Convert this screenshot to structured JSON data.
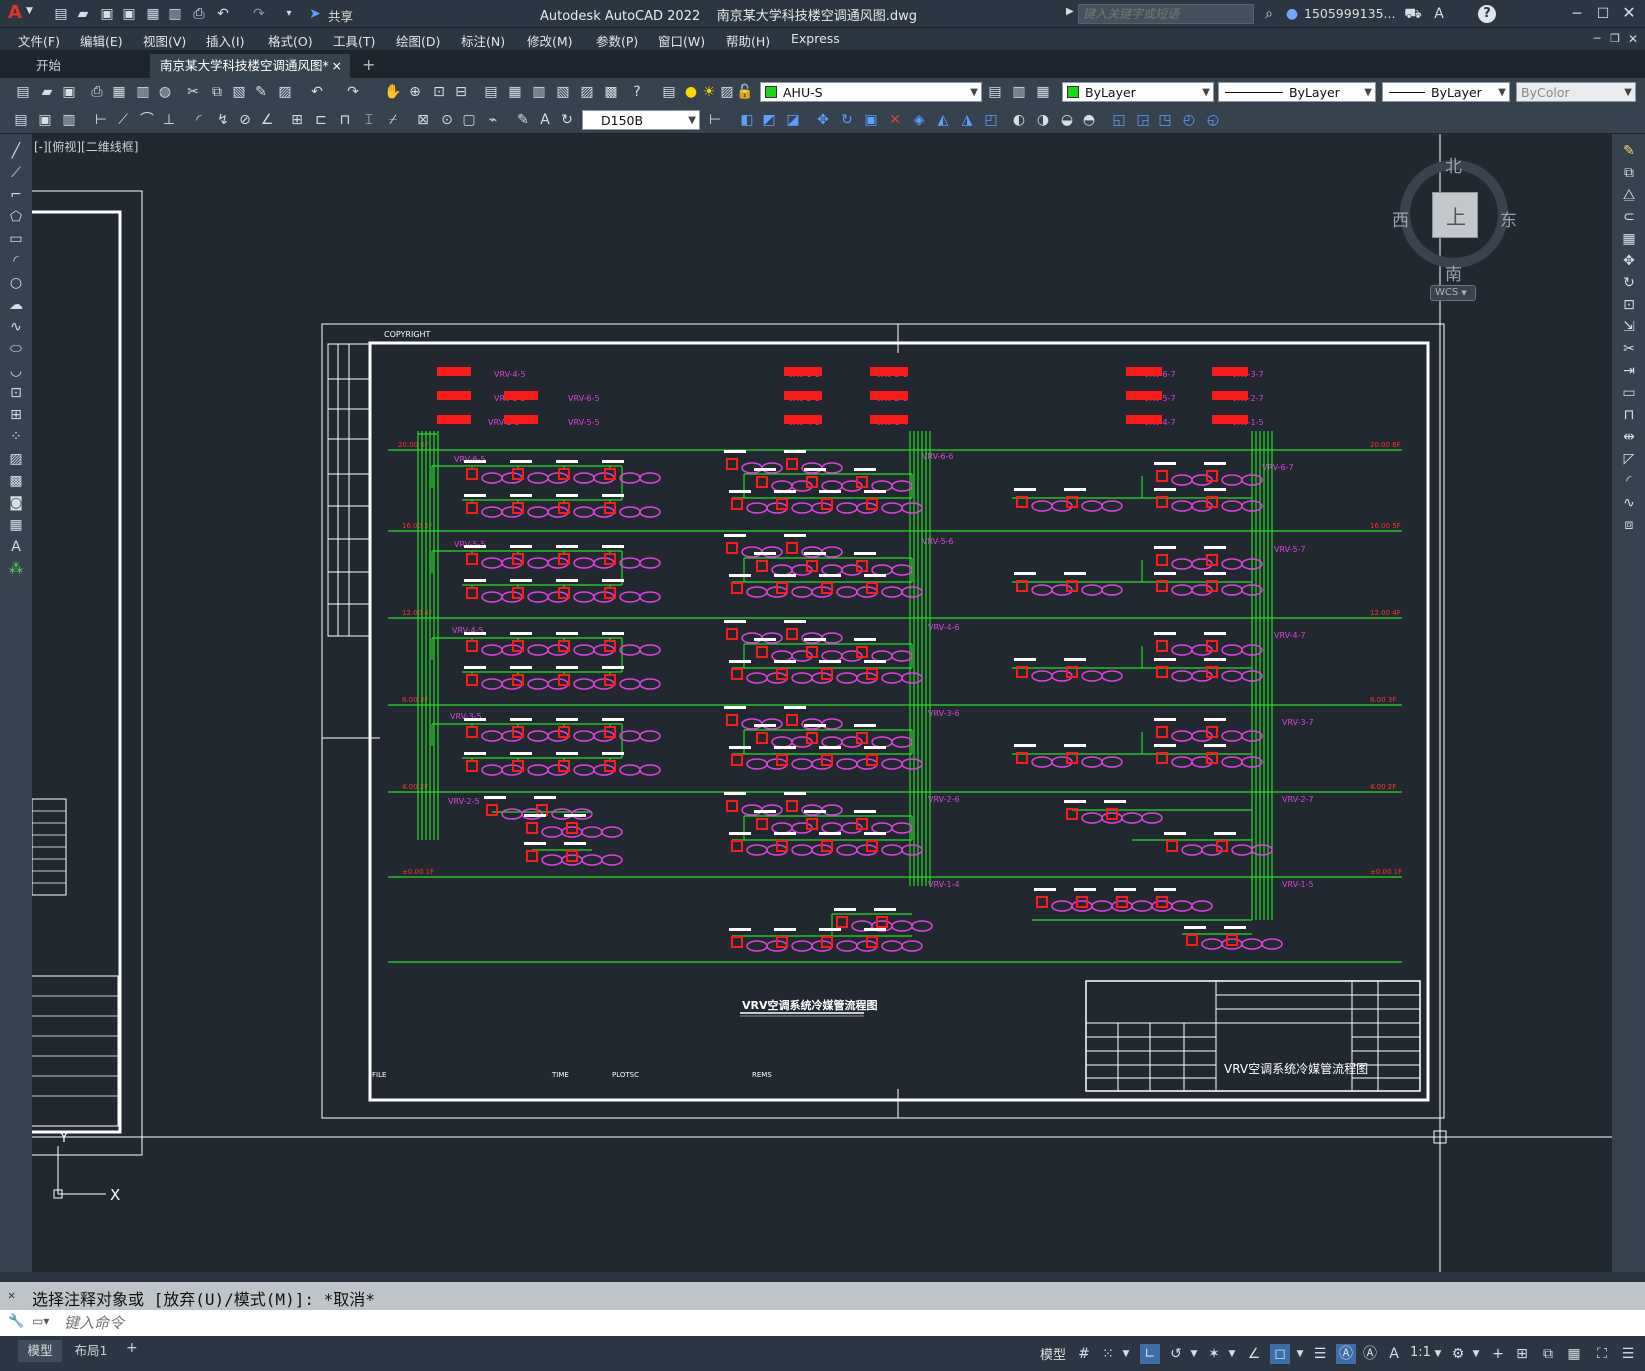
{
  "titlebar": {
    "app_logo": "A",
    "share_label": "共享",
    "title": "Autodesk AutoCAD 2022    南京某大学科技楼空调通风图.dwg",
    "search_placeholder": "键入关键字或短语",
    "user": "1505999135...",
    "help": "?"
  },
  "menu": [
    "文件(F)",
    "编辑(E)",
    "视图(V)",
    "插入(I)",
    "格式(O)",
    "工具(T)",
    "绘图(D)",
    "标注(N)",
    "修改(M)",
    "参数(P)",
    "窗口(W)",
    "帮助(H)",
    "Express"
  ],
  "tabs": {
    "start": "开始",
    "drawing": "南京某大学科技楼空调通风图*",
    "close": "×",
    "add": "+"
  },
  "toolbar": {
    "layer": "AHU-S",
    "color": "ByLayer",
    "linetype": "ByLayer",
    "lineweight": "ByLayer",
    "plotstyle": "ByColor",
    "dimstyle": "D150B"
  },
  "viewport": {
    "label": "[-][俯视][二维线框]",
    "viewcube": {
      "north": "北",
      "south": "南",
      "east": "东",
      "west": "西",
      "top": "上",
      "wcs": "WCS"
    },
    "ucs_x": "X",
    "ucs_y": "Y"
  },
  "drawing": {
    "copyright": "COPYRIGHT",
    "caption": "VRV空调系统冷媒管流程图",
    "title_block_name": "VRV空调系统冷媒管流程图",
    "footer_file": "FILE",
    "footer_time": "TIME",
    "footer_plotsc": "PLOTSC",
    "footer_rems": "REMS",
    "floor_levels": [
      "20.00 6F",
      "16.00 5F",
      "12.00 4F",
      "8.00 3F",
      "4.00 2F",
      "±0.00 1F"
    ],
    "outdoor_units_left": [
      "VRV-4-5",
      "VRV-3-5",
      "VRV-2-5",
      "VRV-6-5",
      "VRV-5-5"
    ],
    "outdoor_units_center": [
      "VRV-6-6",
      "VRV-5-6",
      "VRV-4-6",
      "VRV-3-6",
      "VRV-2-6",
      "VRV-1-4"
    ],
    "outdoor_units_right": [
      "VRV-6-7",
      "VRV-5-7",
      "VRV-4-7",
      "VRV-3-7",
      "VRV-2-7",
      "VRV-1-5"
    ],
    "system_labels_left": [
      "VRV-6-5",
      "VRV-5-5",
      "VRV-4-5",
      "VRV-3-5",
      "VRV-2-5"
    ],
    "system_labels_center": [
      "VRV-6-6",
      "VRV-5-6",
      "VRV-4-6",
      "VRV-3-6",
      "VRV-2-6",
      "VRV-1-4"
    ],
    "system_labels_right": [
      "VRV-6-7",
      "VRV-5-7",
      "VRV-4-7",
      "VRV-3-7",
      "VRV-2-7",
      "VRV-1-5"
    ]
  },
  "command": {
    "history": "选择注释对象或 [放弃(U)/模式(M)]: *取消*",
    "placeholder": "键入命令"
  },
  "layout_tabs": [
    "模型",
    "布局1",
    "+"
  ],
  "status": {
    "model": "模型",
    "scale": "1:1"
  },
  "colors": {
    "background": "#212830",
    "pipe_green": "#22dd22",
    "unit_red": "#ff1a1a",
    "indoor_magenta": "#e040e0",
    "frame_white": "#ffffff"
  }
}
